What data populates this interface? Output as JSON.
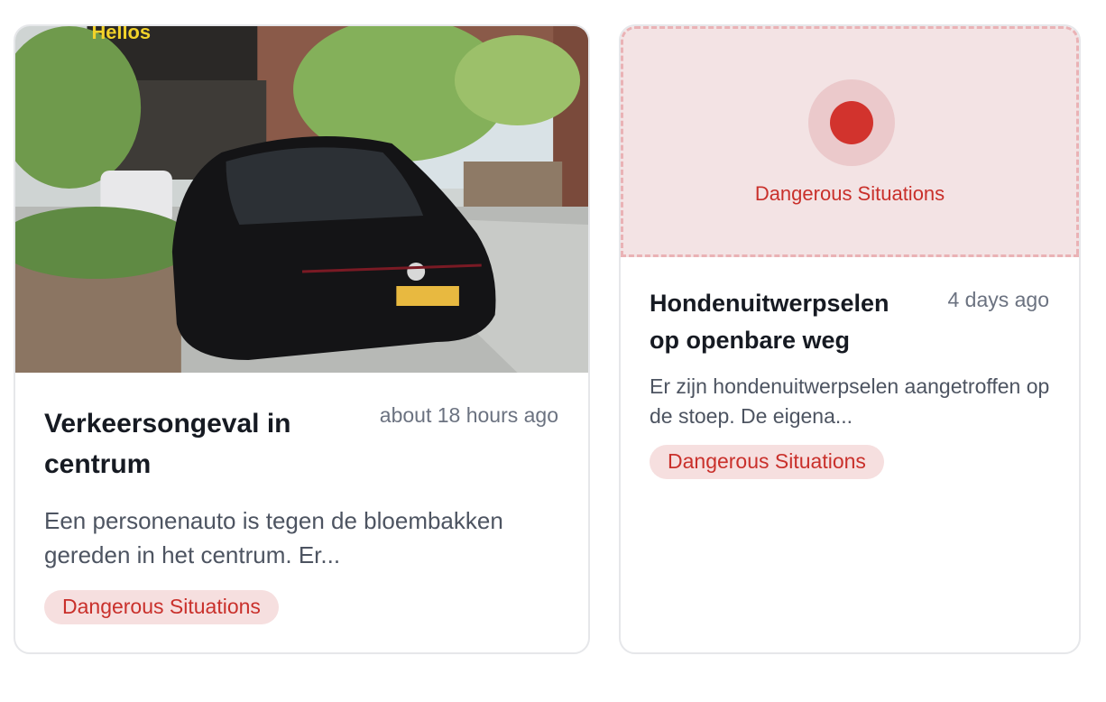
{
  "cards": [
    {
      "title": "Verkeersongeval in centrum",
      "time": "about 18 hours ago",
      "description": "Een personenauto is tegen de bloembakken gereden in het centrum. Er...",
      "category": "Dangerous Situations",
      "photo_sign_text": "Hellos"
    },
    {
      "placeholder_label": "Dangerous Situations",
      "title": "Hondenuitwerpselen op openbare weg",
      "time": "4 days ago",
      "description": "Er zijn hondenuitwerpselen aangetroffen op de stoep. De eigena...",
      "category": "Dangerous Situations"
    }
  ],
  "colors": {
    "danger": "#c9302b",
    "badge_bg": "#f6dfdf",
    "placeholder_bg": "#f3e3e4"
  }
}
